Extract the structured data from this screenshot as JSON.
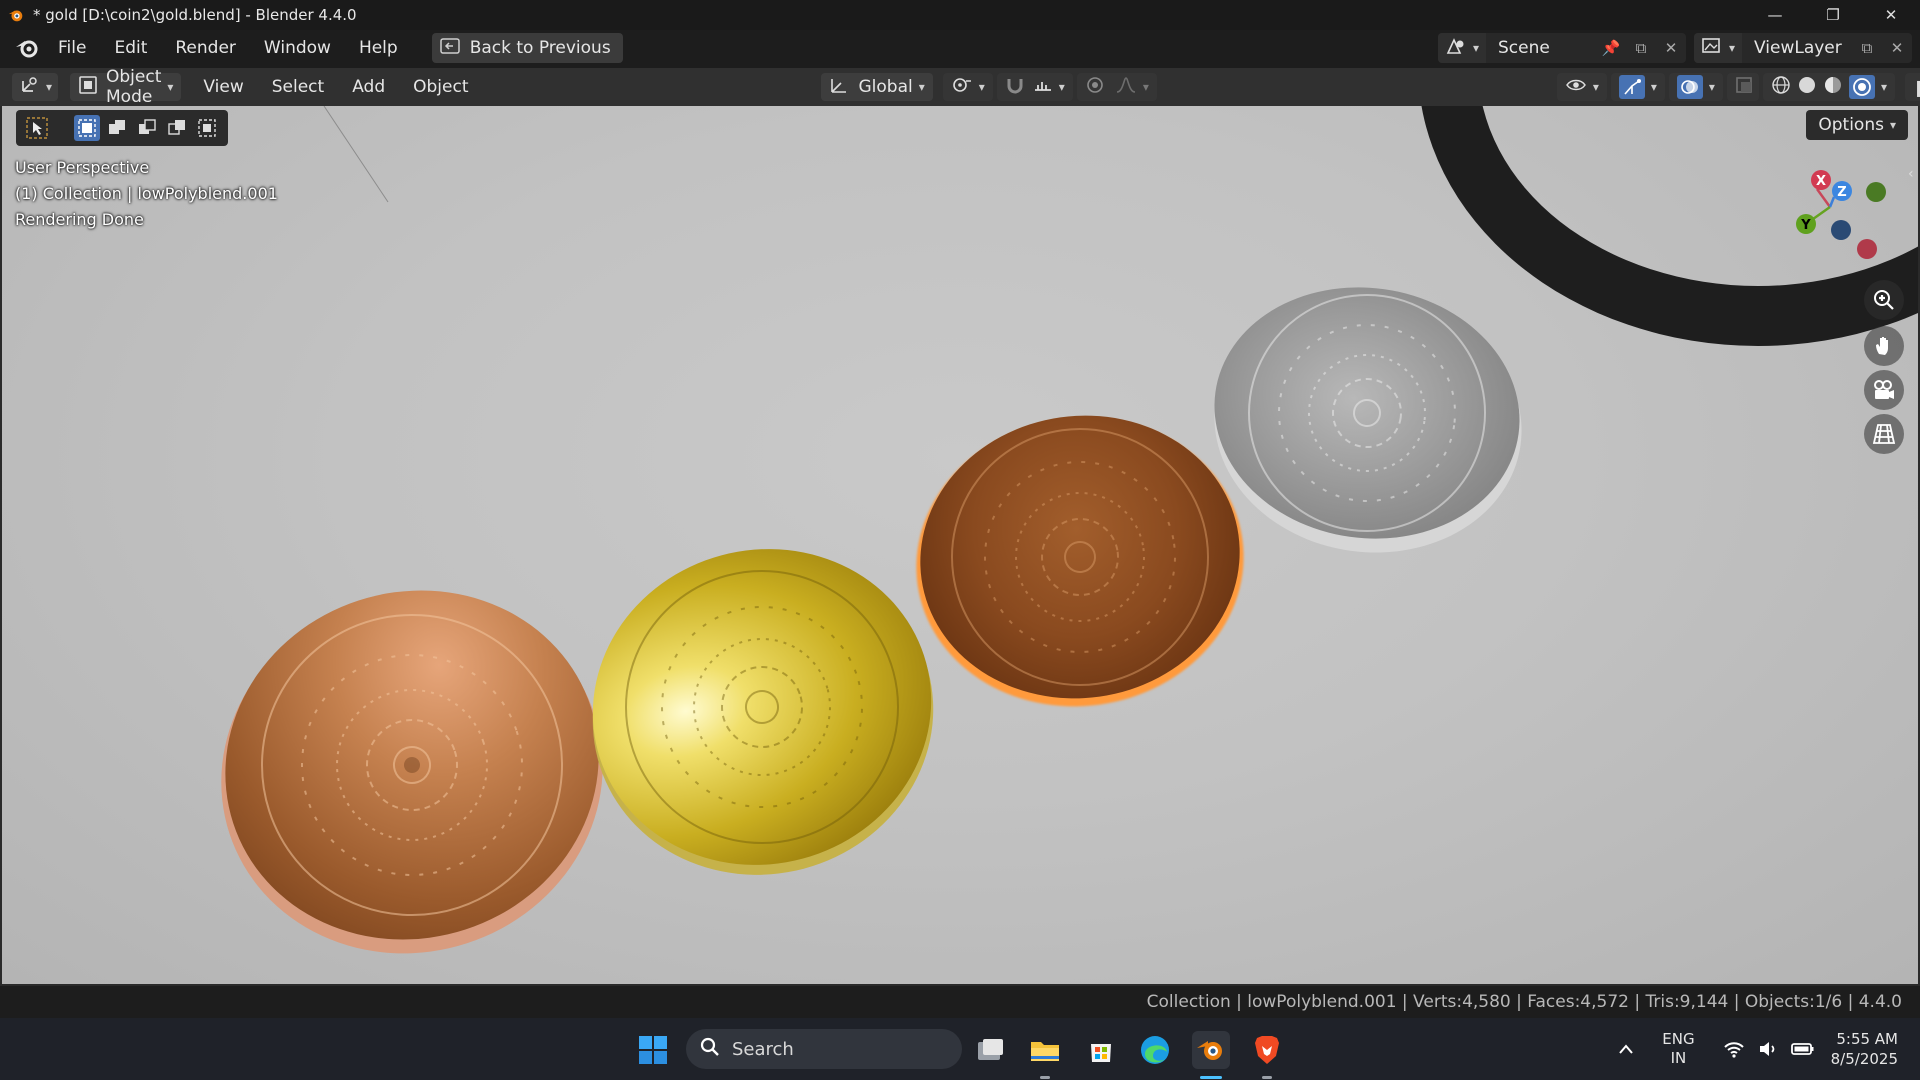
{
  "window": {
    "title": "* gold [D:\\coin2\\gold.blend] - Blender 4.4.0",
    "controls": [
      "minimize",
      "restore",
      "close"
    ]
  },
  "menubar": {
    "items": [
      "File",
      "Edit",
      "Render",
      "Window",
      "Help"
    ],
    "back_button": "Back to Previous",
    "scene": "Scene",
    "view_layer": "ViewLayer"
  },
  "header": {
    "mode": "Object Mode",
    "menus": [
      "View",
      "Select",
      "Add",
      "Object"
    ],
    "transform_orientation": "Global"
  },
  "viewport": {
    "view_name": "User Perspective",
    "collection_line": "(1) Collection | lowPolyblend.001",
    "status": "Rendering Done",
    "options_label": "Options",
    "gizmo_axes": {
      "x": "X",
      "y": "Y",
      "z": "Z"
    },
    "coins": [
      {
        "name": "copper-coin",
        "color": "#b86b3c"
      },
      {
        "name": "gold-coin",
        "color": "#c9a61a"
      },
      {
        "name": "bronze-coin",
        "color": "#8a4a1f"
      },
      {
        "name": "silver-coin",
        "color": "#9c9c9c"
      }
    ],
    "selection_color": "#ff8a1a"
  },
  "statusbar": {
    "stats": "Collection | lowPolyblend.001 | Verts:4,580 | Faces:4,572 | Tris:9,144 | Objects:1/6 | 4.4.0"
  },
  "taskbar": {
    "search_label": "Search",
    "apps": [
      "windows-start-icon",
      "task-view-icon",
      "file-explorer-icon",
      "microsoft-store-icon",
      "edge-icon",
      "blender-icon",
      "brave-icon"
    ],
    "language_line1": "ENG",
    "language_line2": "IN",
    "time": "5:55 AM",
    "date": "8/5/2025"
  }
}
